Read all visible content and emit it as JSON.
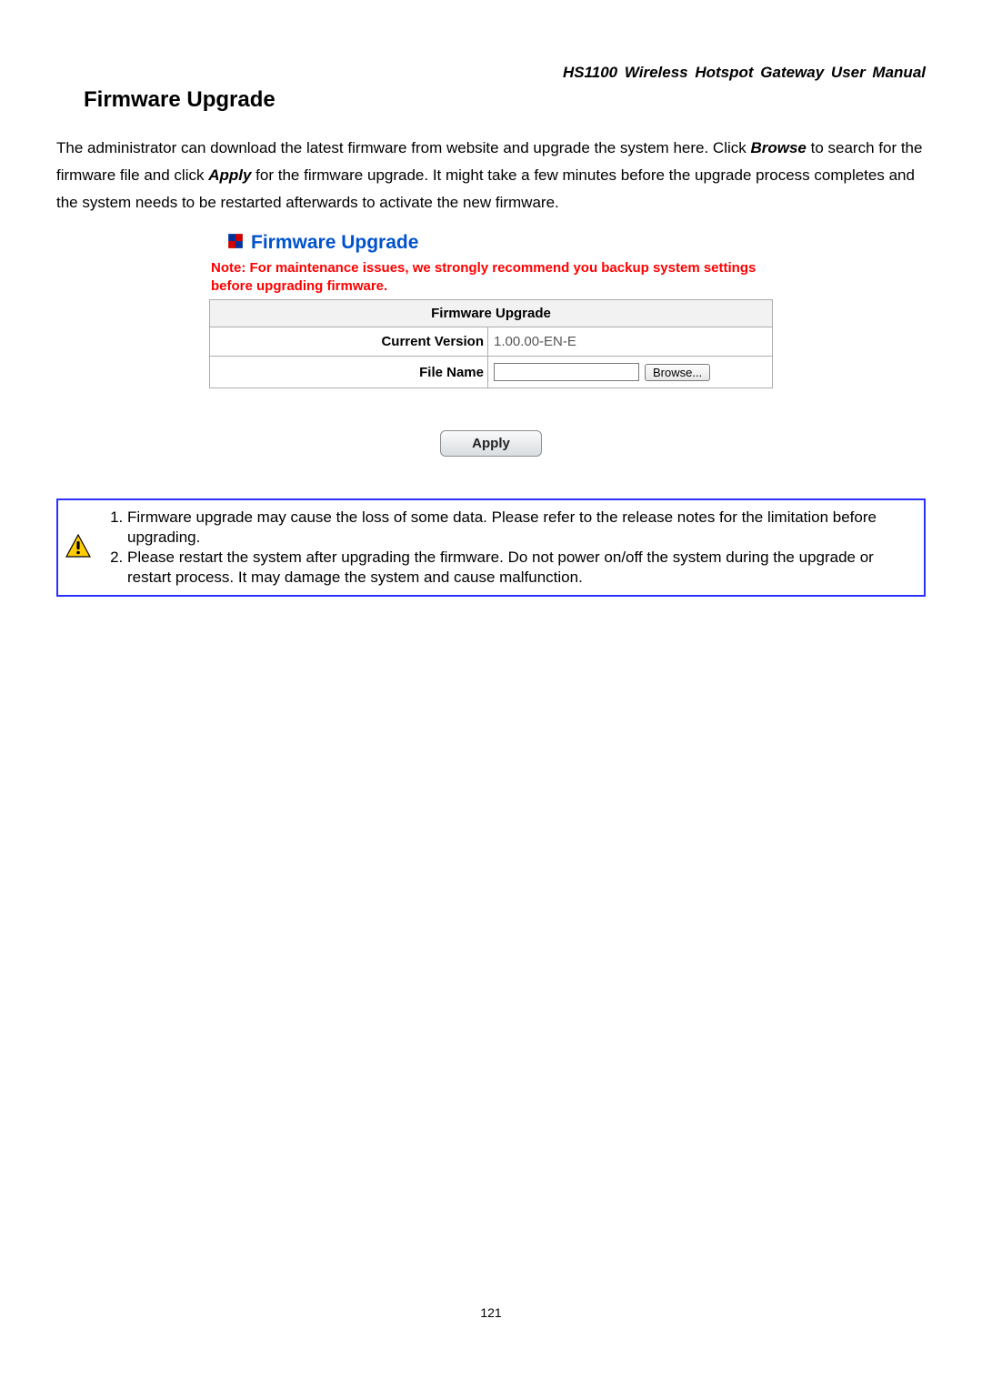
{
  "doc_header": "HS1100 Wireless Hotspot Gateway User Manual",
  "section_title": "Firmware Upgrade",
  "intro": {
    "part1": "The administrator can download the latest firmware from website and upgrade the system here. Click ",
    "browse": "Browse",
    "part2": " to search for the firmware file and click ",
    "apply": "Apply",
    "part3": " for the firmware upgrade. It might take a few minutes before the upgrade process completes and the system needs to be restarted afterwards to activate the new firmware."
  },
  "screenshot": {
    "title": "Firmware Upgrade",
    "note": "Note: For maintenance issues, we strongly recommend you backup system settings before upgrading firmware.",
    "table": {
      "header": "Firmware Upgrade",
      "version_label": "Current Version",
      "version_value": "1.00.00-EN-E",
      "file_label": "File Name",
      "browse_button": "Browse...",
      "apply_button": "Apply"
    }
  },
  "warnings": {
    "item1": "Firmware upgrade may cause the loss of some data. Please refer to the release notes for the limitation before upgrading.",
    "item2": "Please restart the system after upgrading the firmware. Do not power on/off the system during the upgrade or restart process. It may damage the system and cause malfunction."
  },
  "page_number": "121"
}
